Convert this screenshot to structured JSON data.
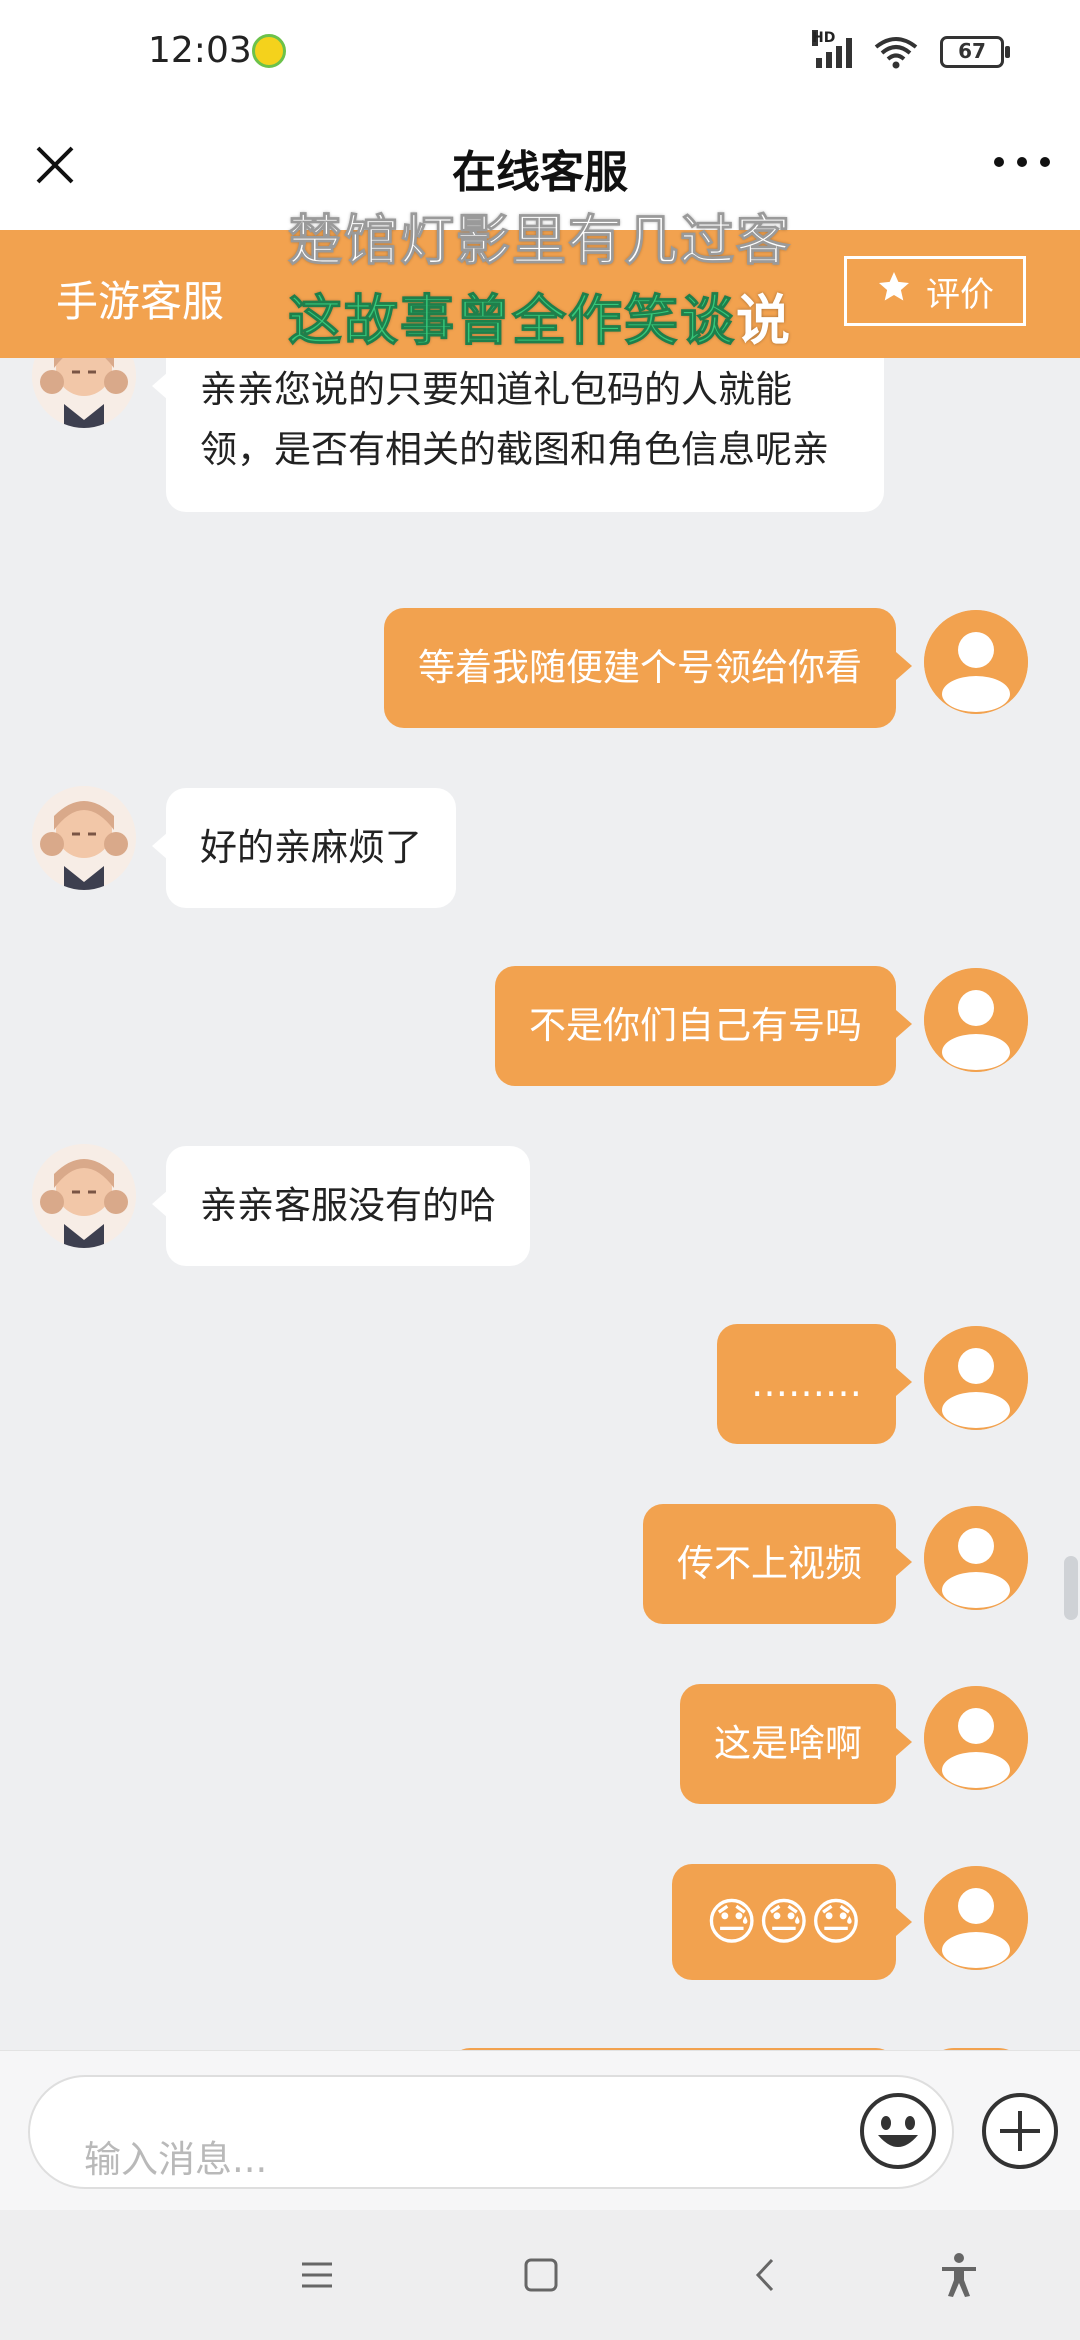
{
  "status_bar": {
    "time": "12:03",
    "network_badge": "HD",
    "battery": "67",
    "icons": [
      "music-app-icon",
      "signal-icon",
      "wifi-icon",
      "battery-icon"
    ]
  },
  "header": {
    "title": "在线客服",
    "close_icon": "close-icon",
    "more_icon": "more-icon"
  },
  "service_bar": {
    "name": "手游客服",
    "rate_label": "评价",
    "rate_icon": "star-icon",
    "background": "#f2a24f"
  },
  "lyrics": {
    "line1": "楚馆灯影里有几过客",
    "line2_highlight": "这故事曾全作笑谈",
    "line2_rest": "说",
    "highlight_color": "#36c97a"
  },
  "messages": [
    {
      "from": "agent",
      "text": "亲亲您说的只要知道礼包码的人就能领，是否有相关的截图和角色信息呢亲"
    },
    {
      "from": "user",
      "text": "等着我随便建个号领给你看"
    },
    {
      "from": "agent",
      "text": "好的亲麻烦了"
    },
    {
      "from": "user",
      "text": "不是你们自己有号吗"
    },
    {
      "from": "agent",
      "text": "亲亲客服没有的哈"
    },
    {
      "from": "user",
      "text": "………"
    },
    {
      "from": "user",
      "text": "传不上视频"
    },
    {
      "from": "user",
      "text": "这是啥啊"
    },
    {
      "from": "user",
      "text": "😓😓😓"
    }
  ],
  "input": {
    "placeholder": "输入消息...",
    "emoji_icon": "emoji-icon",
    "add_icon": "add-icon"
  },
  "nav": {
    "icons": [
      "menu-icon",
      "home-icon",
      "back-icon",
      "accessibility-icon"
    ]
  },
  "colors": {
    "accent": "#f2a24f",
    "background": "#eeeff1",
    "agent_bubble": "#ffffff"
  }
}
